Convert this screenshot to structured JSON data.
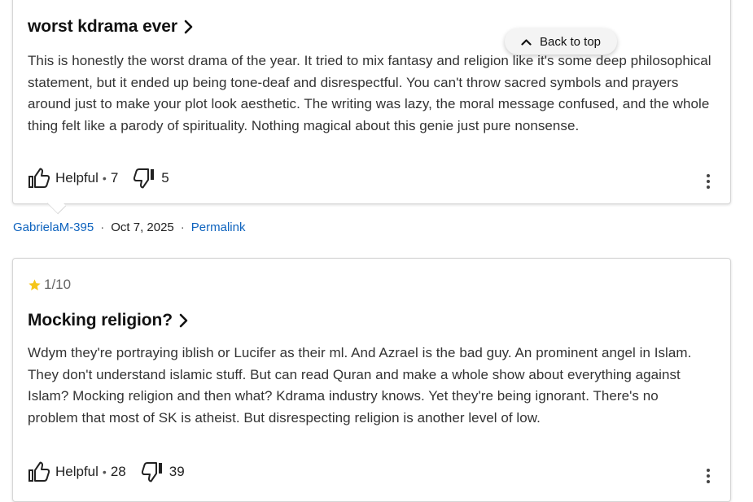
{
  "back_to_top": {
    "label": "Back to top"
  },
  "reviews": [
    {
      "title": "worst kdrama ever",
      "body": "This is honestly the worst drama of the year. It tried to mix fantasy and religion like it's some deep philosophical statement, but it ended up being tone-deaf and disrespectful. You can't throw sacred symbols and prayers around just to make your plot look aesthetic. The writing was lazy, the moral message confused, and the whole thing felt like a parody of spirituality. Nothing magical about this genie just pure nonsense.",
      "helpful_label": "Helpful",
      "helpful_separator": "•",
      "helpful_count": "7",
      "not_helpful_count": "5",
      "author": "GabrielaM-395",
      "date": "Oct 7, 2025",
      "permalink_label": "Permalink",
      "meta_separator": "·"
    },
    {
      "rating": "1/10",
      "title": "Mocking religion?",
      "body": "Wdym they're portraying iblish or Lucifer as their ml. And Azrael is the bad guy. An prominent angel in Islam. They don't understand islamic stuff. But can read Quran and make a whole show about everything against Islam? Mocking religion and then what? Kdrama industry knows. Yet they're being ignorant. There's no problem that most of SK is atheist. But disrespecting religion is another level of low.",
      "helpful_label": "Helpful",
      "helpful_separator": "•",
      "helpful_count": "28",
      "not_helpful_count": "39"
    }
  ],
  "colors": {
    "link": "#0e63be",
    "star": "#f5c518",
    "text": "#121212"
  },
  "icons": [
    "chevron-right-icon",
    "thumbs-up-icon",
    "thumbs-down-icon",
    "more-vertical-icon",
    "star-icon",
    "chevron-up-icon"
  ]
}
